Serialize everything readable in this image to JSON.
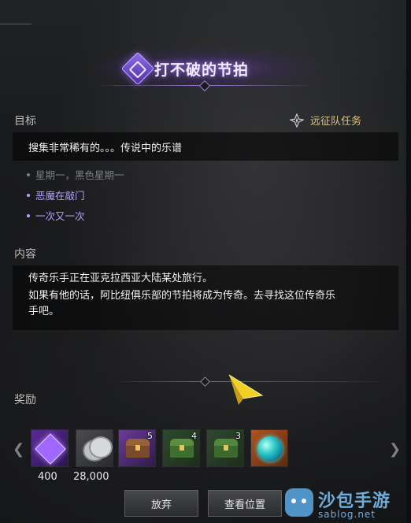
{
  "quest": {
    "title": "打不破的节拍",
    "category": "远征队任务"
  },
  "objective": {
    "label": "目标",
    "text": "搜集非常稀有的。。。传说中的乐谱",
    "subtasks": [
      {
        "text": "星期一，黑色星期一",
        "status": "inactive"
      },
      {
        "text": "恶魔在敲门",
        "status": "active"
      },
      {
        "text": "一次又一次",
        "status": "active"
      }
    ]
  },
  "content": {
    "label": "内容",
    "lines": [
      "传奇乐手正在亚克拉西亚大陆某处旅行。",
      "如果有他的话，阿比纽俱乐部的节拍将成为传奇。去寻找这位传奇乐",
      "手吧。"
    ]
  },
  "rewards": {
    "label": "奖励",
    "items": [
      {
        "icon": "purple-gem-icon",
        "count": "",
        "value": "400"
      },
      {
        "icon": "silver-coins-icon",
        "count": "",
        "value": "28,000"
      },
      {
        "icon": "wooden-chest-icon",
        "count": "5",
        "value": ""
      },
      {
        "icon": "green-chest-icon",
        "count": "4",
        "value": ""
      },
      {
        "icon": "green-chest-icon",
        "count": "3",
        "value": ""
      },
      {
        "icon": "cyan-orb-icon",
        "count": "",
        "value": ""
      }
    ]
  },
  "buttons": {
    "abandon": "放弃",
    "view_location": "查看位置"
  },
  "watermark": {
    "name": "沙包手游",
    "url": "sablog.net"
  },
  "colors": {
    "title_glow": "#9d7de0",
    "active_subtask": "#b7a2ff",
    "inactive_subtask": "#7d7f84",
    "category": "#d9c48a",
    "pointer": "#f5d22e"
  }
}
